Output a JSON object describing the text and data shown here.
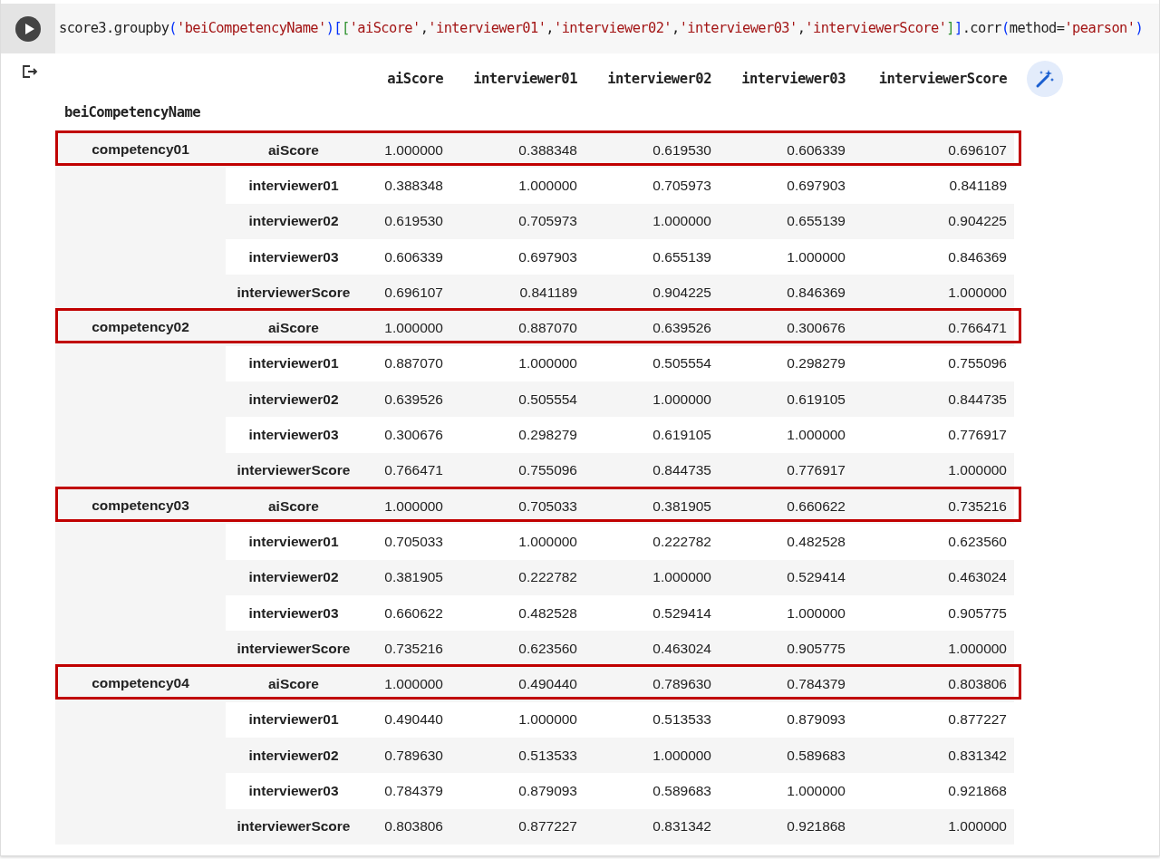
{
  "code_cell": {
    "tokens": [
      {
        "text": "score3.groupby",
        "kind": "plain"
      },
      {
        "text": "(",
        "kind": "bracket1"
      },
      {
        "text": "'beiCompetencyName'",
        "kind": "string"
      },
      {
        "text": ")",
        "kind": "bracket1"
      },
      {
        "text": "[",
        "kind": "bracket1"
      },
      {
        "text": "[",
        "kind": "bracket2"
      },
      {
        "text": "'aiScore'",
        "kind": "string"
      },
      {
        "text": ",",
        "kind": "plain"
      },
      {
        "text": "'interviewer01'",
        "kind": "string"
      },
      {
        "text": ",",
        "kind": "plain"
      },
      {
        "text": "'interviewer02'",
        "kind": "string"
      },
      {
        "text": ",",
        "kind": "plain"
      },
      {
        "text": "'interviewer03'",
        "kind": "string"
      },
      {
        "text": ",",
        "kind": "plain"
      },
      {
        "text": "'interviewerScore'",
        "kind": "string"
      },
      {
        "text": "]",
        "kind": "bracket2"
      },
      {
        "text": "]",
        "kind": "bracket1"
      },
      {
        "text": ".corr",
        "kind": "plain"
      },
      {
        "text": "(",
        "kind": "bracket1"
      },
      {
        "text": "method=",
        "kind": "plain"
      },
      {
        "text": "'pearson'",
        "kind": "string"
      },
      {
        "text": ")",
        "kind": "bracket1"
      }
    ]
  },
  "output": {
    "columns": [
      "aiScore",
      "interviewer01",
      "interviewer02",
      "interviewer03",
      "interviewerScore"
    ],
    "index_name": "beiCompetencyName",
    "groups": [
      {
        "name": "competency01",
        "rows": [
          {
            "label": "aiScore",
            "highlighted": true,
            "values": [
              "1.000000",
              "0.388348",
              "0.619530",
              "0.606339",
              "0.696107"
            ]
          },
          {
            "label": "interviewer01",
            "highlighted": false,
            "values": [
              "0.388348",
              "1.000000",
              "0.705973",
              "0.697903",
              "0.841189"
            ]
          },
          {
            "label": "interviewer02",
            "highlighted": false,
            "values": [
              "0.619530",
              "0.705973",
              "1.000000",
              "0.655139",
              "0.904225"
            ]
          },
          {
            "label": "interviewer03",
            "highlighted": false,
            "values": [
              "0.606339",
              "0.697903",
              "0.655139",
              "1.000000",
              "0.846369"
            ]
          },
          {
            "label": "interviewerScore",
            "highlighted": false,
            "values": [
              "0.696107",
              "0.841189",
              "0.904225",
              "0.846369",
              "1.000000"
            ]
          }
        ]
      },
      {
        "name": "competency02",
        "rows": [
          {
            "label": "aiScore",
            "highlighted": true,
            "values": [
              "1.000000",
              "0.887070",
              "0.639526",
              "0.300676",
              "0.766471"
            ]
          },
          {
            "label": "interviewer01",
            "highlighted": false,
            "values": [
              "0.887070",
              "1.000000",
              "0.505554",
              "0.298279",
              "0.755096"
            ]
          },
          {
            "label": "interviewer02",
            "highlighted": false,
            "values": [
              "0.639526",
              "0.505554",
              "1.000000",
              "0.619105",
              "0.844735"
            ]
          },
          {
            "label": "interviewer03",
            "highlighted": false,
            "values": [
              "0.300676",
              "0.298279",
              "0.619105",
              "1.000000",
              "0.776917"
            ]
          },
          {
            "label": "interviewerScore",
            "highlighted": false,
            "values": [
              "0.766471",
              "0.755096",
              "0.844735",
              "0.776917",
              "1.000000"
            ]
          }
        ]
      },
      {
        "name": "competency03",
        "rows": [
          {
            "label": "aiScore",
            "highlighted": true,
            "values": [
              "1.000000",
              "0.705033",
              "0.381905",
              "0.660622",
              "0.735216"
            ]
          },
          {
            "label": "interviewer01",
            "highlighted": false,
            "values": [
              "0.705033",
              "1.000000",
              "0.222782",
              "0.482528",
              "0.623560"
            ]
          },
          {
            "label": "interviewer02",
            "highlighted": false,
            "values": [
              "0.381905",
              "0.222782",
              "1.000000",
              "0.529414",
              "0.463024"
            ]
          },
          {
            "label": "interviewer03",
            "highlighted": false,
            "values": [
              "0.660622",
              "0.482528",
              "0.529414",
              "1.000000",
              "0.905775"
            ]
          },
          {
            "label": "interviewerScore",
            "highlighted": false,
            "values": [
              "0.735216",
              "0.623560",
              "0.463024",
              "0.905775",
              "1.000000"
            ]
          }
        ]
      },
      {
        "name": "competency04",
        "rows": [
          {
            "label": "aiScore",
            "highlighted": true,
            "values": [
              "1.000000",
              "0.490440",
              "0.789630",
              "0.784379",
              "0.803806"
            ]
          },
          {
            "label": "interviewer01",
            "highlighted": false,
            "values": [
              "0.490440",
              "1.000000",
              "0.513533",
              "0.879093",
              "0.877227"
            ]
          },
          {
            "label": "interviewer02",
            "highlighted": false,
            "values": [
              "0.789630",
              "0.513533",
              "1.000000",
              "0.589683",
              "0.831342"
            ]
          },
          {
            "label": "interviewer03",
            "highlighted": false,
            "values": [
              "0.784379",
              "0.879093",
              "0.589683",
              "1.000000",
              "0.921868"
            ]
          },
          {
            "label": "interviewerScore",
            "highlighted": false,
            "values": [
              "0.803806",
              "0.877227",
              "0.831342",
              "0.921868",
              "1.000000"
            ]
          }
        ]
      }
    ]
  }
}
